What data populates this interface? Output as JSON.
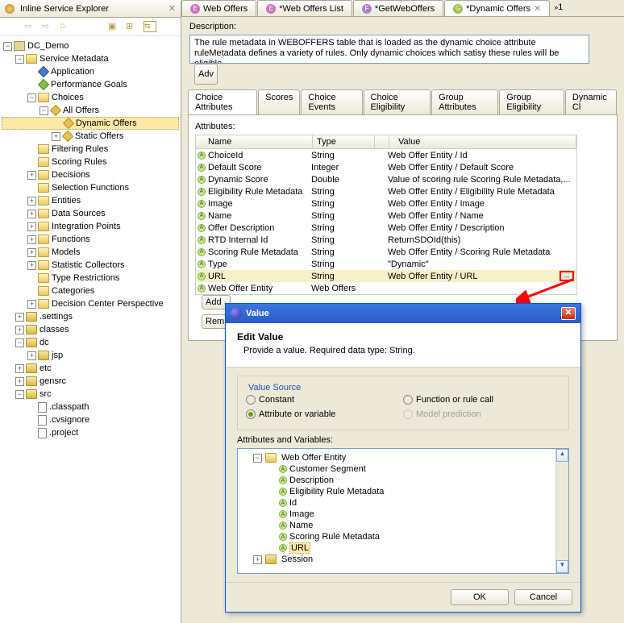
{
  "explorer": {
    "title": "Inline Service Explorer",
    "root": "DC_Demo",
    "sm": "Service Metadata",
    "app": "Application",
    "perf": "Performance Goals",
    "choices": "Choices",
    "allOffers": "All Offers",
    "dynOffers": "Dynamic Offers",
    "statOffers": "Static Offers",
    "filtRules": "Filtering Rules",
    "scorRules": "Scoring Rules",
    "decisions": "Decisions",
    "selFunc": "Selection Functions",
    "entities": "Entities",
    "dataSrc": "Data Sources",
    "intPts": "Integration Points",
    "functions": "Functions",
    "models": "Models",
    "statColl": "Statistic Collectors",
    "typeRes": "Type Restrictions",
    "categories": "Categories",
    "decPersp": "Decision Center Perspective",
    "settings": ".settings",
    "classes": "classes",
    "dc": "dc",
    "jsp": "jsp",
    "etc": "etc",
    "gensrc": "gensrc",
    "src": "src",
    "classpath": ".classpath",
    "cvsignore": ".cvsignore",
    "project": ".project"
  },
  "tabs": {
    "t1": "Web Offers",
    "t2": "*Web Offers List",
    "t3": "*GetWebOffers",
    "t4": "*Dynamic Offers",
    "more": "1"
  },
  "desc": {
    "label": "Description:",
    "text": "The rule metadata in WEBOFFERS table that is loaded as the dynamic choice attribute ruleMetadata defines a variety of rules. Only dynamic choices which satisy these rules will be eligible.",
    "adv": "Adv"
  },
  "subtabs": [
    "Choice Attributes",
    "Scores",
    "Choice Events",
    "Choice Eligibility",
    "Group Attributes",
    "Group Eligibility",
    "Dynamic Cl"
  ],
  "attr": {
    "label": "Attributes:",
    "cols": {
      "name": "Name",
      "type": "Type",
      "value": "Value"
    },
    "rows": [
      {
        "n": "ChoiceId",
        "t": "String",
        "v": "Web Offer Entity / Id"
      },
      {
        "n": "Default Score",
        "t": "Integer",
        "v": "Web Offer Entity / Default Score"
      },
      {
        "n": "Dynamic Score",
        "t": "Double",
        "v": "Value of scoring rule Scoring Rule Metadata,..."
      },
      {
        "n": "Eligibility Rule Metadata",
        "t": "String",
        "v": "Web Offer Entity / Eligibility Rule Metadata"
      },
      {
        "n": "Image",
        "t": "String",
        "v": "Web Offer Entity / Image"
      },
      {
        "n": "Name",
        "t": "String",
        "v": "Web Offer Entity / Name"
      },
      {
        "n": "Offer Description",
        "t": "String",
        "v": "Web Offer Entity / Description"
      },
      {
        "n": "RTD Internal Id",
        "t": "String",
        "v": "ReturnSDOId(this)"
      },
      {
        "n": "Scoring Rule Metadata",
        "t": "String",
        "v": "Web Offer Entity / Scoring Rule Metadata"
      },
      {
        "n": "Type",
        "t": "String",
        "v": "\"Dynamic\""
      },
      {
        "n": "URL",
        "t": "String",
        "v": "Web Offer Entity / URL"
      },
      {
        "n": "Web Offer Entity",
        "t": "Web Offers",
        "v": ""
      }
    ],
    "add": "Add",
    "rem": "Rem"
  },
  "dialog": {
    "title": "Value",
    "heading": "Edit Value",
    "sub": "Provide a value. Required data type: String.",
    "legend": "Value Source",
    "r1": "Constant",
    "r2": "Function or rule call",
    "r3": "Attribute or variable",
    "r4": "Model prediction",
    "avLabel": "Attributes and Variables:",
    "entity": "Web Offer Entity",
    "items": [
      "Customer Segment",
      "Description",
      "Eligibility Rule Metadata",
      "Id",
      "Image",
      "Name",
      "Scoring Rule Metadata",
      "URL"
    ],
    "session": "Session",
    "ok": "OK",
    "cancel": "Cancel"
  }
}
